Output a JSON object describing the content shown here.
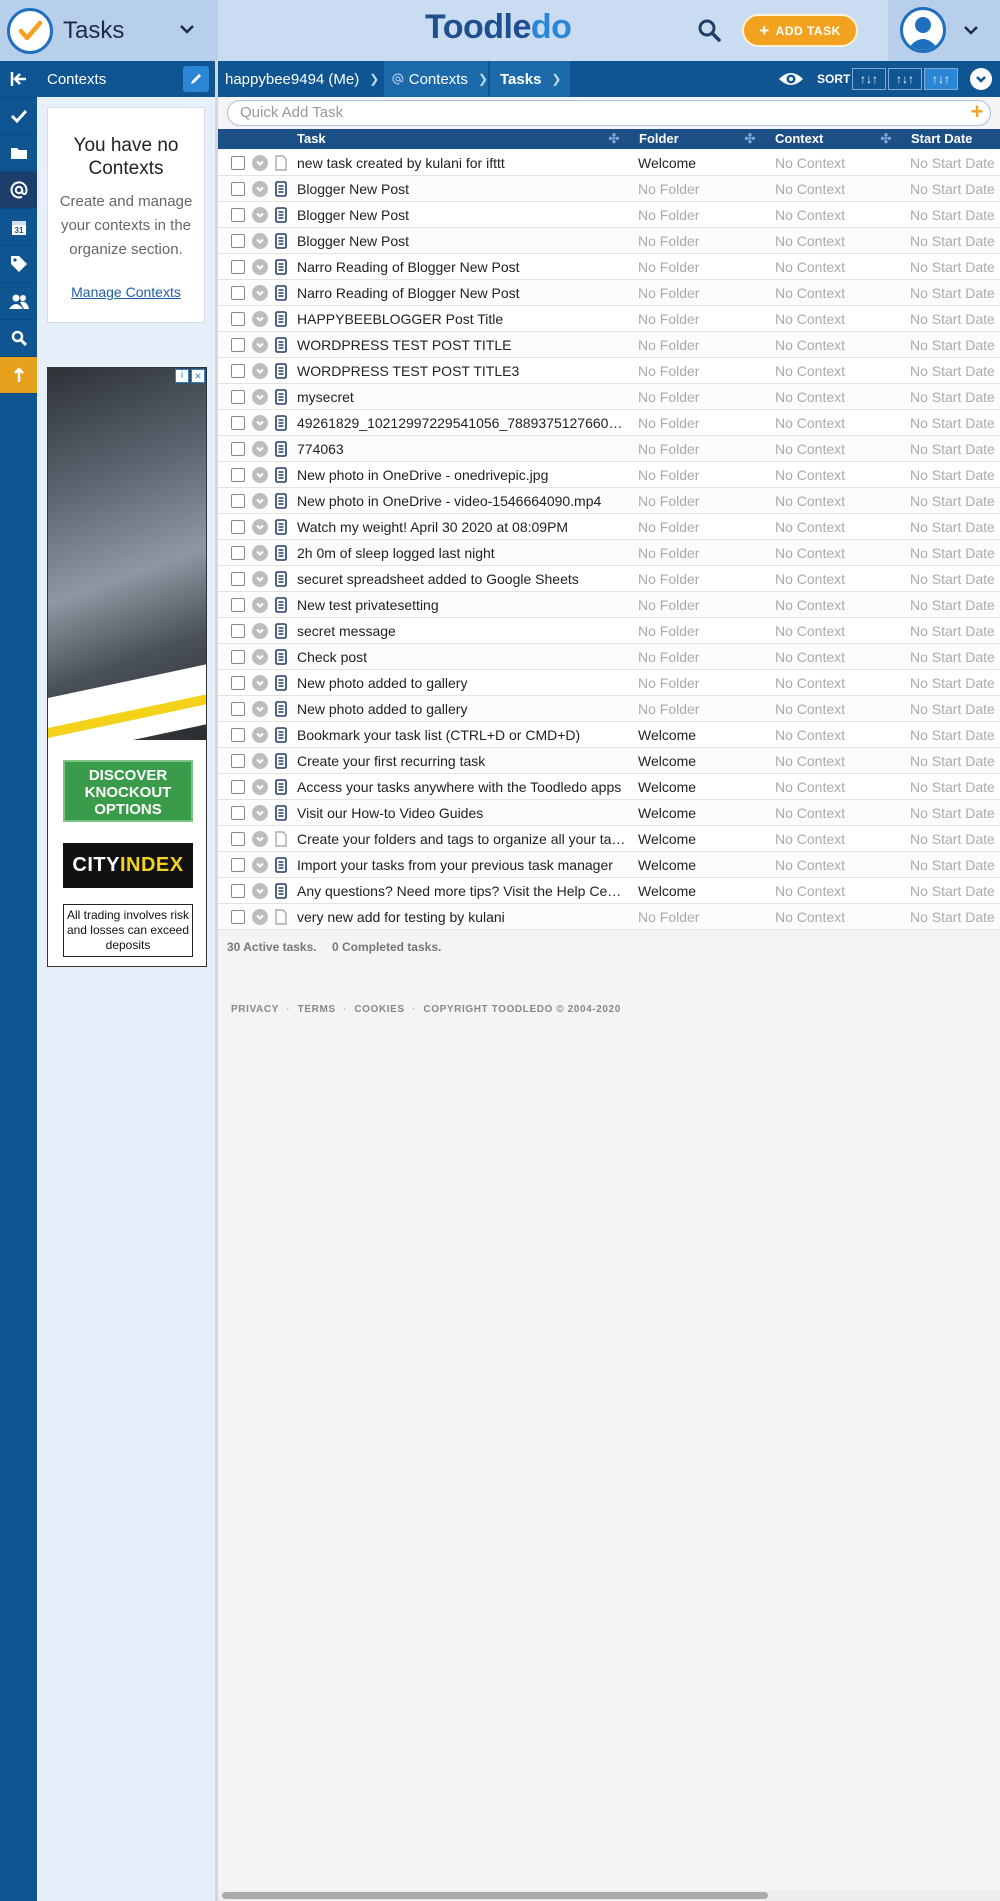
{
  "header": {
    "app_title": "Tasks",
    "brand": "Toodledo",
    "add_task_label": "ADD TASK"
  },
  "rail": {
    "items": [
      "collapse-icon",
      "check-icon",
      "folder-icon",
      "at-icon",
      "calendar-icon",
      "tag-icon",
      "users-icon",
      "search-icon",
      "upgrade-icon"
    ],
    "calendar_day": "31"
  },
  "sidebar": {
    "title": "Contexts",
    "empty_title": "You have no Contexts",
    "empty_desc": "Create and manage your contexts in the organize section.",
    "manage_link": "Manage Contexts"
  },
  "ad": {
    "cta": "DISCOVER KNOCKOUT OPTIONS",
    "brand_a": "CITY",
    "brand_b": "INDEX",
    "disclaimer": "All trading involves risk and losses can exceed deposits"
  },
  "breadcrumb": {
    "user": "happybee9494 (Me)",
    "contexts": "Contexts",
    "tasks": "Tasks",
    "sort_label": "SORT"
  },
  "quick_add": {
    "placeholder": "Quick Add Task"
  },
  "columns": {
    "task": "Task",
    "folder": "Folder",
    "context": "Context",
    "start": "Start Date"
  },
  "tasks": [
    {
      "title": "new task created by kulani for ifttt",
      "folder": "Welcome",
      "context": "No Context",
      "start": "No Start Date",
      "has_note": false
    },
    {
      "title": "Blogger New Post",
      "folder": "No Folder",
      "context": "No Context",
      "start": "No Start Date",
      "has_note": true
    },
    {
      "title": "Blogger New Post",
      "folder": "No Folder",
      "context": "No Context",
      "start": "No Start Date",
      "has_note": true
    },
    {
      "title": "Blogger New Post",
      "folder": "No Folder",
      "context": "No Context",
      "start": "No Start Date",
      "has_note": true
    },
    {
      "title": "Narro Reading of Blogger New Post",
      "folder": "No Folder",
      "context": "No Context",
      "start": "No Start Date",
      "has_note": true
    },
    {
      "title": "Narro Reading of Blogger New Post",
      "folder": "No Folder",
      "context": "No Context",
      "start": "No Start Date",
      "has_note": true
    },
    {
      "title": "HAPPYBEEBLOGGER Post Title",
      "folder": "No Folder",
      "context": "No Context",
      "start": "No Start Date",
      "has_note": true
    },
    {
      "title": "WORDPRESS TEST POST TITLE",
      "folder": "No Folder",
      "context": "No Context",
      "start": "No Start Date",
      "has_note": true
    },
    {
      "title": "WORDPRESS TEST POST TITLE3",
      "folder": "No Folder",
      "context": "No Context",
      "start": "No Start Date",
      "has_note": true
    },
    {
      "title": "mysecret",
      "folder": "No Folder",
      "context": "No Context",
      "start": "No Start Date",
      "has_note": true
    },
    {
      "title": "49261829_10212997229541056_7889375127660…",
      "folder": "No Folder",
      "context": "No Context",
      "start": "No Start Date",
      "has_note": true
    },
    {
      "title": "774063",
      "folder": "No Folder",
      "context": "No Context",
      "start": "No Start Date",
      "has_note": true
    },
    {
      "title": "New photo in OneDrive - onedrivepic.jpg",
      "folder": "No Folder",
      "context": "No Context",
      "start": "No Start Date",
      "has_note": true
    },
    {
      "title": "New photo in OneDrive - video-1546664090.mp4",
      "folder": "No Folder",
      "context": "No Context",
      "start": "No Start Date",
      "has_note": true
    },
    {
      "title": "Watch my weight! April 30 2020 at 08:09PM",
      "folder": "No Folder",
      "context": "No Context",
      "start": "No Start Date",
      "has_note": true
    },
    {
      "title": "2h 0m of sleep logged last night",
      "folder": "No Folder",
      "context": "No Context",
      "start": "No Start Date",
      "has_note": true
    },
    {
      "title": "securet spreadsheet added to Google Sheets",
      "folder": "No Folder",
      "context": "No Context",
      "start": "No Start Date",
      "has_note": true
    },
    {
      "title": "New test privatesetting",
      "folder": "No Folder",
      "context": "No Context",
      "start": "No Start Date",
      "has_note": true
    },
    {
      "title": "secret message",
      "folder": "No Folder",
      "context": "No Context",
      "start": "No Start Date",
      "has_note": true
    },
    {
      "title": "Check post",
      "folder": "No Folder",
      "context": "No Context",
      "start": "No Start Date",
      "has_note": true
    },
    {
      "title": "New photo added to gallery",
      "folder": "No Folder",
      "context": "No Context",
      "start": "No Start Date",
      "has_note": true
    },
    {
      "title": "New photo added to gallery",
      "folder": "No Folder",
      "context": "No Context",
      "start": "No Start Date",
      "has_note": true
    },
    {
      "title": "Bookmark your task list (CTRL+D or CMD+D)",
      "folder": "Welcome",
      "context": "No Context",
      "start": "No Start Date",
      "has_note": true
    },
    {
      "title": "Create your first recurring task",
      "folder": "Welcome",
      "context": "No Context",
      "start": "No Start Date",
      "has_note": true
    },
    {
      "title": "Access your tasks anywhere with the Toodledo apps",
      "folder": "Welcome",
      "context": "No Context",
      "start": "No Start Date",
      "has_note": true
    },
    {
      "title": "Visit our How-to Video Guides",
      "folder": "Welcome",
      "context": "No Context",
      "start": "No Start Date",
      "has_note": true
    },
    {
      "title": "Create your folders and tags to organize all your ta…",
      "folder": "Welcome",
      "context": "No Context",
      "start": "No Start Date",
      "has_note": false
    },
    {
      "title": "Import your tasks from your previous task manager",
      "folder": "Welcome",
      "context": "No Context",
      "start": "No Start Date",
      "has_note": true
    },
    {
      "title": "Any questions? Need more tips? Visit the Help Ce…",
      "folder": "Welcome",
      "context": "No Context",
      "start": "No Start Date",
      "has_note": true
    },
    {
      "title": "very new add for testing by kulani",
      "folder": "No Folder",
      "context": "No Context",
      "start": "No Start Date",
      "has_note": false
    }
  ],
  "summary": {
    "active": "30 Active tasks.",
    "completed": "0 Completed tasks."
  },
  "footer": {
    "privacy": "PRIVACY",
    "terms": "TERMS",
    "cookies": "COOKIES",
    "copyright": "COPYRIGHT TOODLEDO © 2004-2020"
  },
  "colors": {
    "nav_blue": "#0e5591",
    "accent_orange": "#f3a21f",
    "header_blue": "#c9dcf2"
  }
}
